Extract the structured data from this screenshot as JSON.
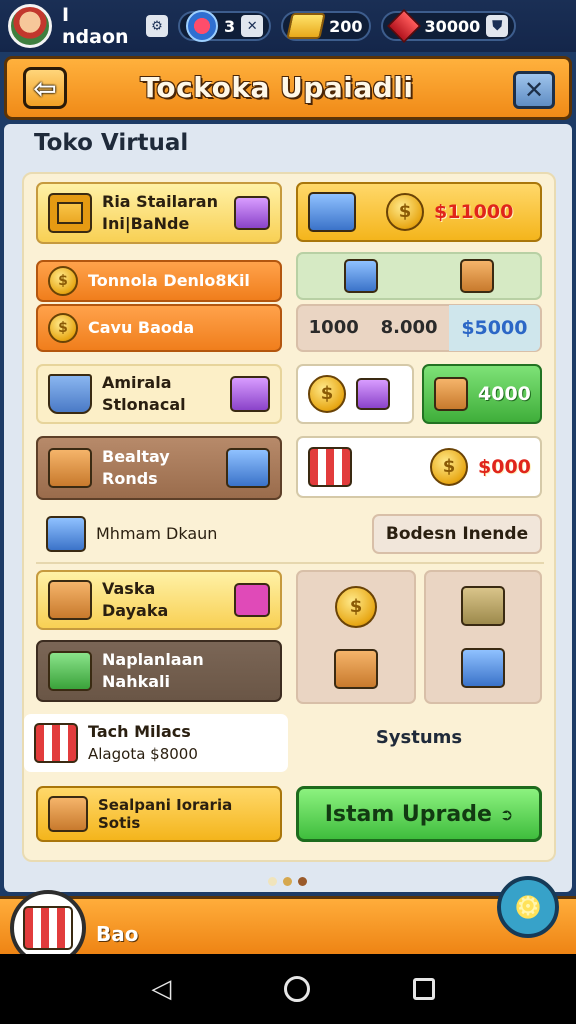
{
  "topbar": {
    "player_name": "I ndaon",
    "gems": "3",
    "gold": "200",
    "rubies": "30000"
  },
  "header": {
    "title": "Tockoka Upaiadli",
    "back_icon": "back-arrow-icon",
    "close_icon": "close-icon"
  },
  "section_title": "Toko Virtual",
  "left_items": [
    {
      "label": "Ria Stailaran Ini|BaNde",
      "icon": "picture-frame-icon"
    },
    {
      "label": "Tonnola Denlo8Kil",
      "icon": "coin-stack-icon"
    },
    {
      "label": "Cavu Baoda",
      "icon": "coin-stack-icon"
    },
    {
      "label": "Amirala Stlonacal",
      "icon": "shopping-cart-icon"
    },
    {
      "label": "Bealtay Ronds",
      "icon": "storage-box-icon"
    },
    {
      "label": "Mhmam Dkaun",
      "icon": "display-crate-icon"
    },
    {
      "label": "Vaska Dayaka",
      "icon": "cardboard-box-icon"
    },
    {
      "label": "Naplanlaan Nahkali",
      "icon": "green-basket-icon"
    },
    {
      "label": "Tach Milacs",
      "sub": "Alagota $8000",
      "icon": "market-stall-icon"
    },
    {
      "label": "Sealpani Ioraria Sotis",
      "icon": "cardboard-box-icon"
    }
  ],
  "right_items": {
    "price_1": "$11000",
    "row_values": [
      "1000",
      "8.000",
      "$5000"
    ],
    "price_2": "4000",
    "price_3": "$000",
    "bodesn_label": "Bodesn Inende",
    "systems_label": "Systums"
  },
  "upgrade_button": {
    "label": "Istam Uprade",
    "icon": "arrow-right-icon"
  },
  "pager": {
    "active_page": 2,
    "total_pages": 3
  },
  "bottombar": {
    "label": "Bao"
  },
  "colors": {
    "orange": "#f08a17",
    "green": "#3fbd3d",
    "navy": "#1d3b66",
    "cream": "#fbf1d5"
  }
}
